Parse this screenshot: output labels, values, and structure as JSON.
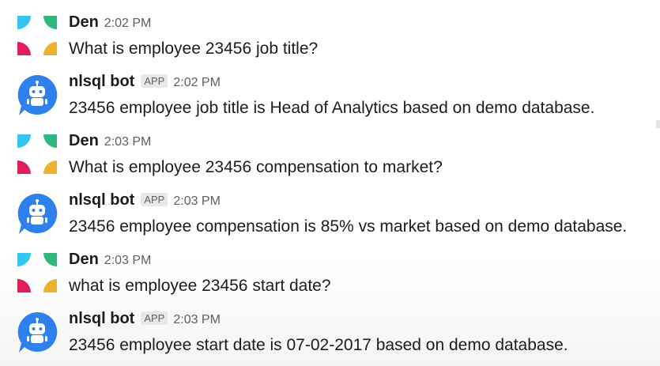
{
  "messages": [
    {
      "sender": "Den",
      "time": "2:02 PM",
      "text": "What is employee 23456 job title?",
      "is_bot": false
    },
    {
      "sender": "nlsql bot",
      "badge": "APP",
      "time": "2:02 PM",
      "text": "23456 employee job title is Head of Analytics based on demo database.",
      "is_bot": true
    },
    {
      "sender": "Den",
      "time": "2:03 PM",
      "text": "What is employee 23456 compensation to market?",
      "is_bot": false
    },
    {
      "sender": "nlsql bot",
      "badge": "APP",
      "time": "2:03 PM",
      "text": "23456 employee compensation is 85% vs market based on demo database.",
      "is_bot": true
    },
    {
      "sender": "Den",
      "time": "2:03 PM",
      "text": "what is employee 23456 start date?",
      "is_bot": false
    },
    {
      "sender": "nlsql bot",
      "badge": "APP",
      "time": "2:03 PM",
      "text": "23456 employee start date is 07-02-2017 based on demo database.",
      "is_bot": true
    }
  ],
  "colors": {
    "slack_cyan": "#36c5f0",
    "slack_green": "#2eb67d",
    "slack_red": "#e01e5a",
    "slack_yellow": "#ecb22e",
    "bot_blue": "#2f80ed"
  },
  "icons": {
    "user_avatar": "slack-quad-avatar-icon",
    "bot_avatar": "robot-chat-bubble-icon"
  }
}
